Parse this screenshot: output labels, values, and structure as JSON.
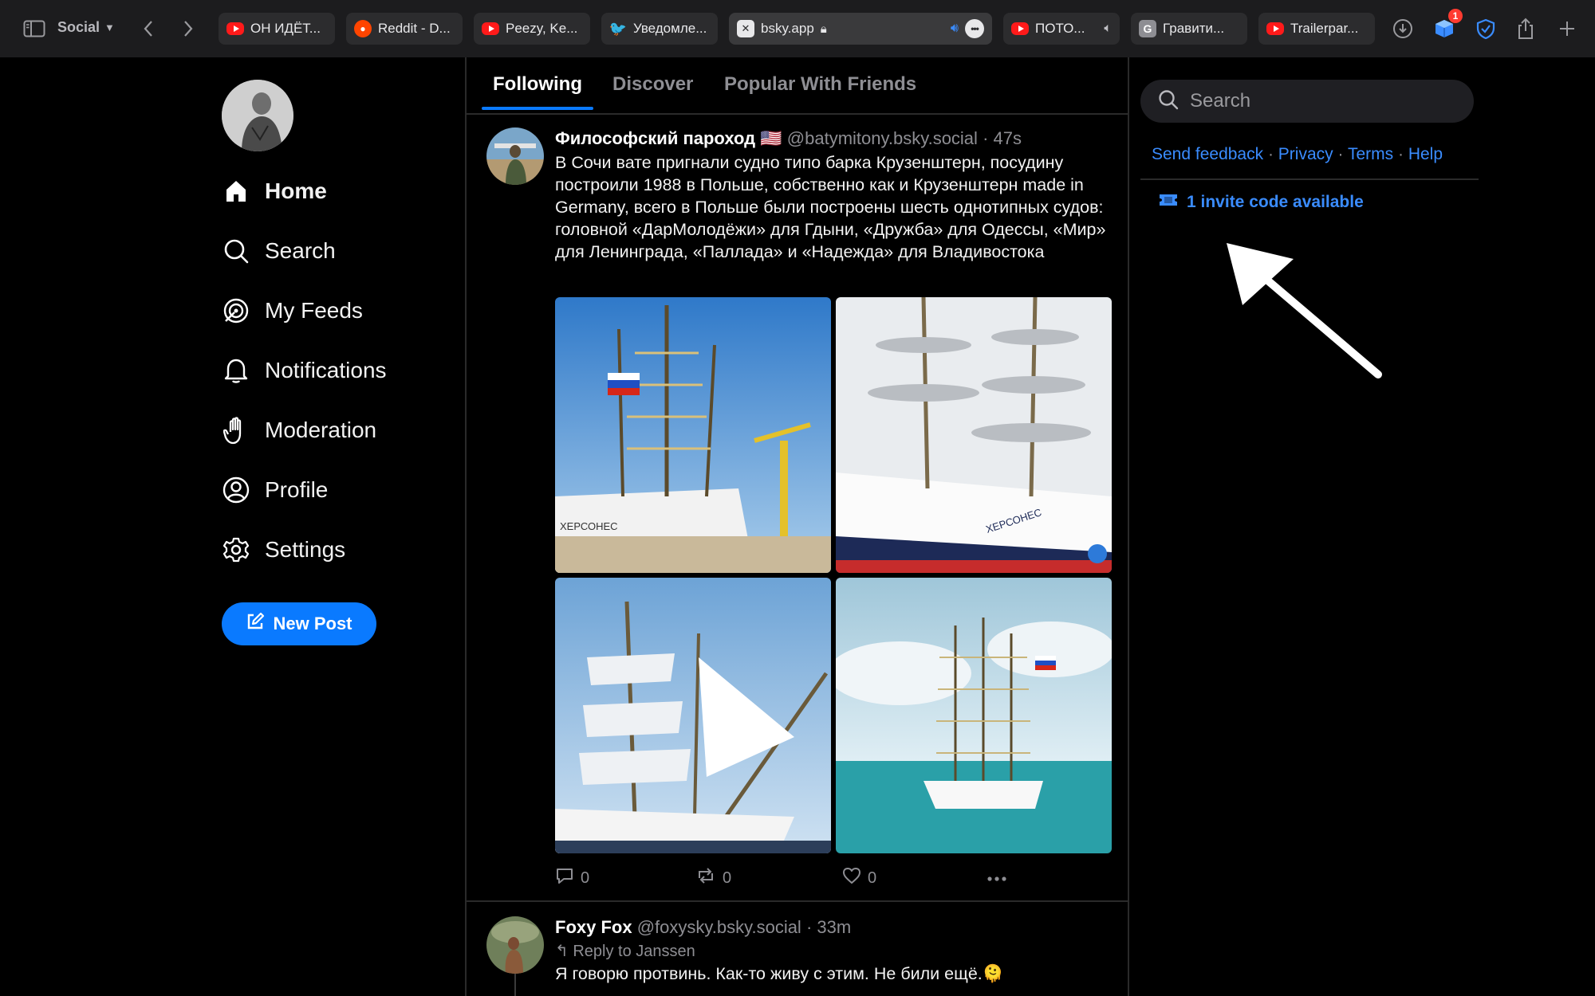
{
  "browser": {
    "tab_group": "Social",
    "tabs": [
      {
        "title": "ОН ИДЁТ...",
        "favicon": "youtube-icon"
      },
      {
        "title": "Reddit - D...",
        "favicon": "reddit-icon"
      },
      {
        "title": "Peezy, Ke...",
        "favicon": "youtube-icon"
      },
      {
        "title": "Уведомле...",
        "favicon": "twitter-icon"
      },
      {
        "title": "bsky.app",
        "favicon": "x-icon",
        "active": true
      },
      {
        "title": "ПОТО...",
        "favicon": "youtube-icon"
      },
      {
        "title": "Гравити...",
        "favicon": "g-icon",
        "favicon_letter": "G"
      },
      {
        "title": "Trailerpar...",
        "favicon": "youtube-icon"
      }
    ],
    "extension_badge": "1"
  },
  "nav": {
    "items": [
      {
        "label": "Home",
        "icon": "home-icon",
        "active": true
      },
      {
        "label": "Search",
        "icon": "search-icon"
      },
      {
        "label": "My Feeds",
        "icon": "feeds-icon"
      },
      {
        "label": "Notifications",
        "icon": "bell-icon"
      },
      {
        "label": "Moderation",
        "icon": "hand-icon"
      },
      {
        "label": "Profile",
        "icon": "profile-icon"
      },
      {
        "label": "Settings",
        "icon": "gear-icon"
      }
    ],
    "new_post_label": "New Post"
  },
  "feed": {
    "tabs": [
      "Following",
      "Discover",
      "Popular With Friends"
    ],
    "active_tab": "Following",
    "posts": [
      {
        "author": "Философский пароход",
        "flag": "🇺🇸",
        "handle": "@batymitony.bsky.social",
        "time": "· 47s",
        "text": "В Сочи вате пригнали судно типо барка Крузенштерн, посудину построили 1988 в Польше, собственно как и Крузенштерн made in Germany, всего в Польше были построены шесть однотипных судов: головной «ДарМолодёжи» для Гдыни, «Дружба» для Одессы, «Мир» для Ленинграда, «Паллада» и «Надежда» для Владивостока",
        "images": [
          "tall-ship-photo-1",
          "tall-ship-photo-2",
          "tall-ship-photo-3",
          "tall-ship-photo-4"
        ],
        "ship_name_on_hull": "ХЕРСОНЕС",
        "replies": "0",
        "reposts": "0",
        "likes": "0"
      },
      {
        "author": "Foxy Fox",
        "handle": "@foxysky.bsky.social",
        "time": "· 33m",
        "reply_prefix": "Reply to",
        "reply_to": "Janssen",
        "text": "Я говорю протвинь. Как-то живу с этим. Не били ещё.🫠"
      }
    ]
  },
  "sidebar": {
    "search_placeholder": "Search",
    "links": [
      "Send feedback",
      "Privacy",
      "Terms",
      "Help"
    ],
    "separator": "·",
    "invite": "1 invite code available"
  },
  "colors": {
    "accent": "#0a7aff",
    "link": "#3a8cff",
    "background": "#000000",
    "chrome": "#1c1c1e"
  }
}
